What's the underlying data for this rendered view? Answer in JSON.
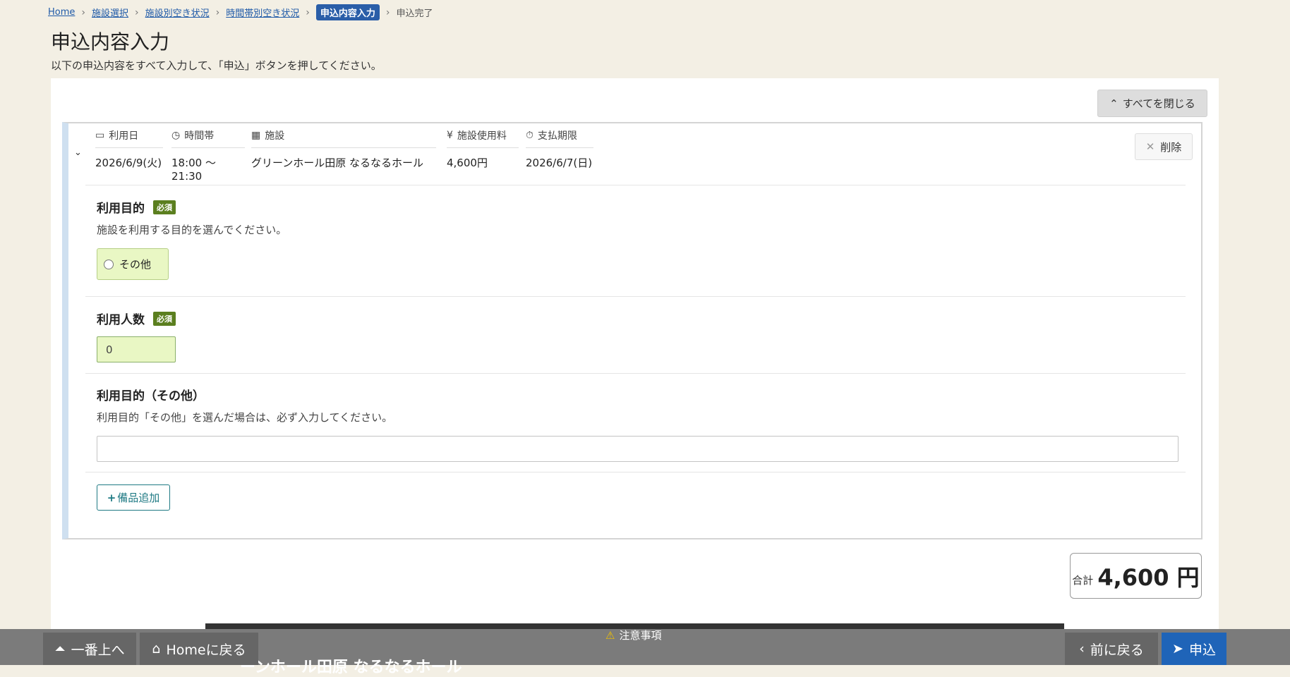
{
  "breadcrumb": {
    "items": [
      "Home",
      "施設選択",
      "施設別空き状況",
      "時間帯別空き状況"
    ],
    "current": "申込内容入力",
    "next": "申込完了"
  },
  "page": {
    "title": "申込内容入力",
    "subtitle": "以下の申込内容をすべて入力して、「申込」ボタンを押してください。",
    "close_all": "すべてを閉じる"
  },
  "summary": {
    "headers": [
      "利用日",
      "時間帯",
      "施設",
      "施設使用料",
      "支払期限"
    ],
    "values": [
      "2026/6/9(火)",
      "18:00 ～ 21:30",
      "グリーンホール田原 なるなるホール",
      "4,600円",
      "2026/6/7(日)"
    ],
    "delete": "削除"
  },
  "form": {
    "purpose_label": "利用目的",
    "required": "必須",
    "purpose_desc": "施設を利用する目的を選んでください。",
    "purpose_option": "その他",
    "people_label": "利用人数",
    "people_value": "0",
    "other_label": "利用目的（その他）",
    "other_desc": "利用目的「その他」を選んだ場合は、必ず入力してください。",
    "other_value": "",
    "add_equipment": "備品追加"
  },
  "total": {
    "label": "合計",
    "amount": "4,600 円"
  },
  "footer": {
    "top": "一番上へ",
    "home": "Homeに戻る",
    "notice": "注意事項",
    "behind_text": "ーンホール田原 なるなるホール",
    "back": "前に戻る",
    "apply": "申込"
  },
  "colors": {
    "accent": "#1f64b8",
    "required_badge": "#5b7f1f",
    "input_bg": "#e9f7c4",
    "add_button": "#1f7a84"
  }
}
